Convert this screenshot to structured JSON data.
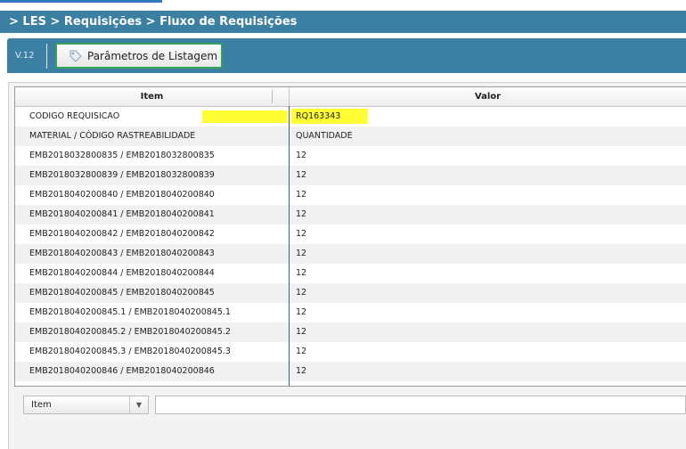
{
  "breadcrumb": "> LES > Requisições > Fluxo de Requisições",
  "toolbar": {
    "version": "V.12",
    "params_button": "Parâmetros de Listagem"
  },
  "grid": {
    "columns": [
      "Item",
      "Valor"
    ],
    "rows": [
      {
        "item": "CODIGO REQUISICAO",
        "valor": "RQ163343"
      },
      {
        "item": "MATERIAL / CÓDIGO RASTREABILIDADE",
        "valor": "QUANTIDADE"
      },
      {
        "item": "EMB2018032800835 / EMB2018032800835",
        "valor": "12"
      },
      {
        "item": "EMB2018032800839 / EMB2018032800839",
        "valor": "12"
      },
      {
        "item": "EMB2018040200840 / EMB2018040200840",
        "valor": "12"
      },
      {
        "item": "EMB2018040200841 / EMB2018040200841",
        "valor": "12"
      },
      {
        "item": "EMB2018040200842 / EMB2018040200842",
        "valor": "12"
      },
      {
        "item": "EMB2018040200843 / EMB2018040200843",
        "valor": "12"
      },
      {
        "item": "EMB2018040200844 / EMB2018040200844",
        "valor": "12"
      },
      {
        "item": "EMB2018040200845 / EMB2018040200845",
        "valor": "12"
      },
      {
        "item": "EMB2018040200845.1 / EMB2018040200845.1",
        "valor": "12"
      },
      {
        "item": "EMB2018040200845.2 / EMB2018040200845.2",
        "valor": "12"
      },
      {
        "item": "EMB2018040200845.3 / EMB2018040200845.3",
        "valor": "12"
      },
      {
        "item": "EMB2018040200846 / EMB2018040200846",
        "valor": "12"
      }
    ]
  },
  "filter": {
    "select_value": "Item",
    "input_value": ""
  },
  "colors": {
    "header_bar": "#3b7fa3",
    "highlight": "#ffff33",
    "button_border": "#37a35a"
  }
}
